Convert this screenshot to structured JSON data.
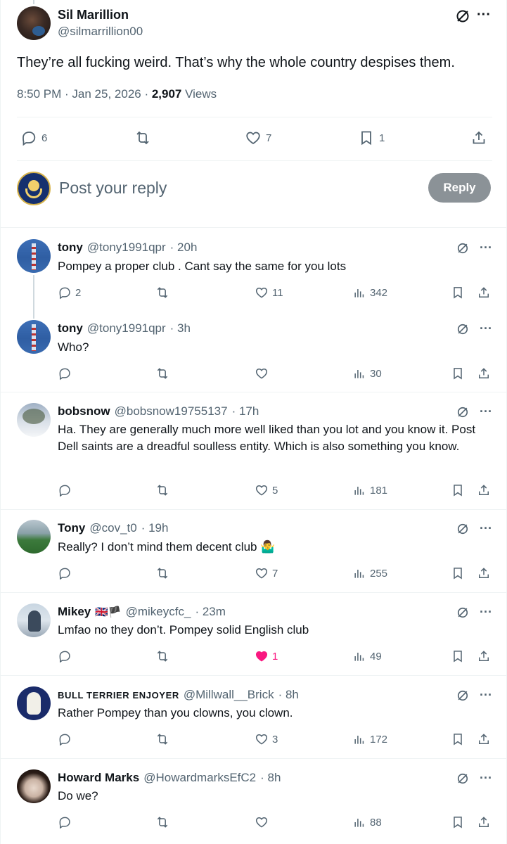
{
  "main_tweet": {
    "author_name": "Sil Marillion",
    "author_handle": "@silmarrillion00",
    "text": "They’re all fucking weird. That’s why the whole country despises them.",
    "time": "8:50 PM · Jan 25, 2026 · ",
    "views_count": "2,907",
    "views_label": " Views",
    "replies": "6",
    "reposts": "",
    "likes": "7",
    "bookmarks": "1"
  },
  "composer": {
    "placeholder": "Post your reply",
    "reply_button": "Reply"
  },
  "replies": [
    {
      "name": "tony",
      "handle": "@tony1991qpr",
      "time": "· 20h",
      "text": "Pompey a proper club . Cant say the same for you lots",
      "replies": "2",
      "reposts": "",
      "likes": "11",
      "views": "342",
      "liked": false
    },
    {
      "name": "tony",
      "handle": "@tony1991qpr",
      "time": "· 3h",
      "text": "Who?",
      "replies": "",
      "reposts": "",
      "likes": "",
      "views": "30",
      "liked": false
    },
    {
      "name": "bobsnow",
      "handle": "@bobsnow19755137",
      "time": "· 17h",
      "text": "Ha. They are generally much more well liked than you lot and you know it. Post Dell saints are a dreadful soulless entity. Which is also something you know.",
      "replies": "",
      "reposts": "",
      "likes": "5",
      "views": "181",
      "liked": false
    },
    {
      "name": "Tony",
      "handle": "@cov_t0",
      "time": "· 19h",
      "text": "Really? I don’t mind them decent club 🤷‍♂️",
      "replies": "",
      "reposts": "",
      "likes": "7",
      "views": "255",
      "liked": false
    },
    {
      "name": "Mikey",
      "flags": "🇬🇧🏴",
      "handle": "@mikeycfc_",
      "time": "· 23m",
      "text": "Lmfao no they don’t. Pompey solid English club",
      "replies": "",
      "reposts": "",
      "likes": "1",
      "views": "49",
      "liked": true
    },
    {
      "name": "BULL TERRIER ENJOYER",
      "handle": "@Millwall__Brick",
      "time": "· 8h",
      "text": "Rather Pompey than you clowns, you clown.",
      "replies": "",
      "reposts": "",
      "likes": "3",
      "views": "172",
      "liked": false
    },
    {
      "name": "Howard Marks",
      "handle": "@HowardmarksEfC2",
      "time": "· 8h",
      "text": "Do we?",
      "replies": "",
      "reposts": "",
      "likes": "",
      "views": "88",
      "liked": false
    }
  ],
  "colors": {
    "text": "#0f1419",
    "muted": "#536471",
    "like": "#f91880",
    "divider": "#eff3f4"
  }
}
